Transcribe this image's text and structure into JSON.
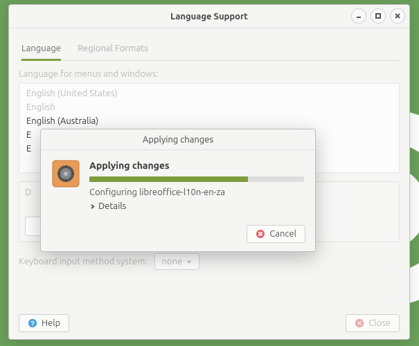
{
  "window": {
    "title": "Language Support",
    "tabs": [
      {
        "label": "Language",
        "active": true
      },
      {
        "label": "Regional Formats",
        "active": false
      }
    ],
    "section_label": "Language for menus and windows:",
    "languages": [
      {
        "name": "English (United States)",
        "enabled": false
      },
      {
        "name": "English",
        "enabled": false
      },
      {
        "name": "English (Australia)",
        "enabled": true
      },
      {
        "name": "E",
        "enabled": true
      },
      {
        "name": "E",
        "enabled": true
      }
    ],
    "input_method_label": "Keyboard input method system:",
    "input_method_value": "none",
    "help_label": "Help",
    "close_label": "Close"
  },
  "dialog": {
    "title": "Applying changes",
    "heading": "Applying changes",
    "status": "Configuring libreoffice-l10n-en-za",
    "details_label": "Details",
    "cancel_label": "Cancel",
    "progress_percent": 74
  }
}
